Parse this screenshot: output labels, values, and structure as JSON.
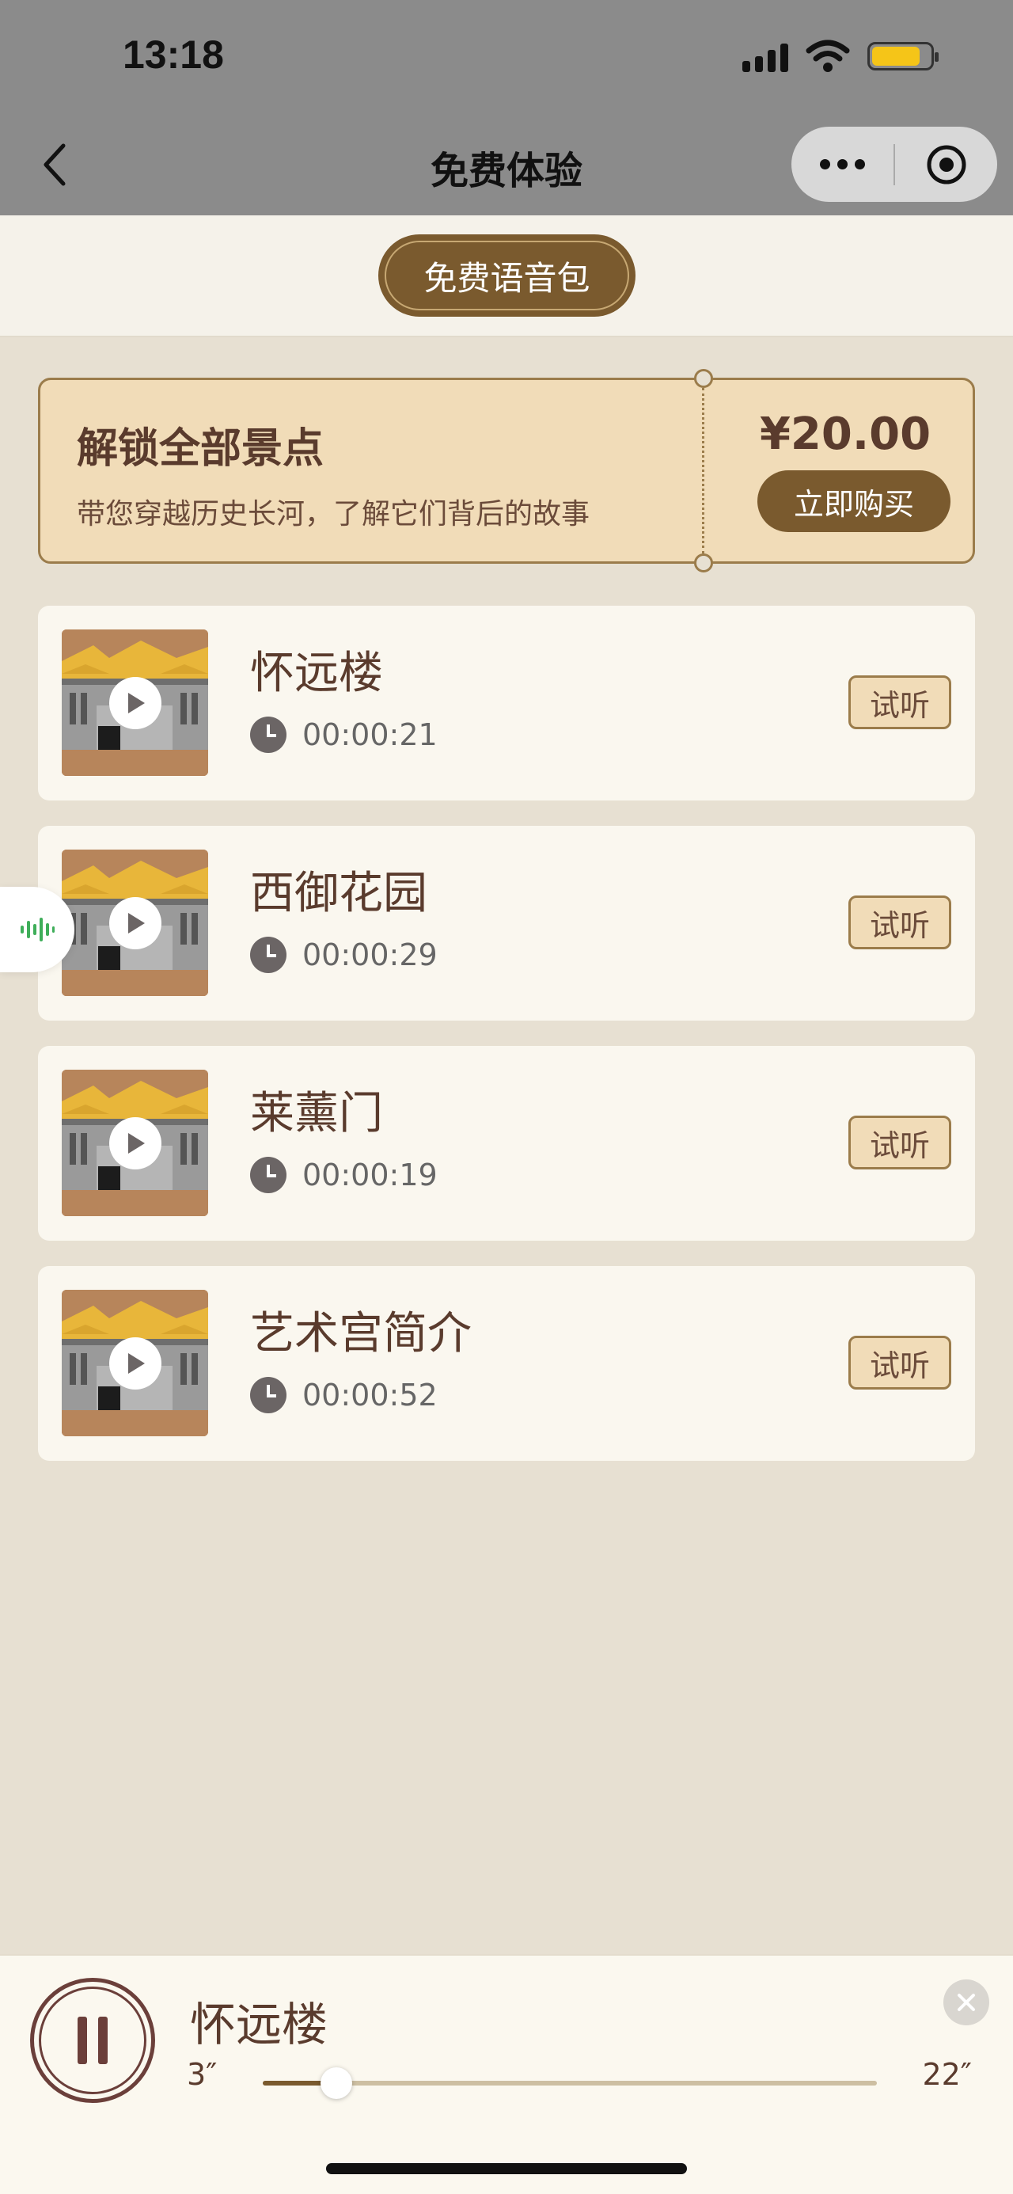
{
  "status_bar": {
    "time": "13:18",
    "battery_level": 0.84,
    "battery_color": "#f5c518"
  },
  "nav": {
    "title": "免费体验",
    "back_icon": "chevron-left-icon",
    "more_icon": "more-dots-icon",
    "close_icon": "target-circle-icon"
  },
  "header_pill": {
    "label": "免费语音包"
  },
  "unlock": {
    "title": "解锁全部景点",
    "subtitle": "带您穿越历史长河，了解它们背后的故事",
    "price": "¥20.00",
    "buy_label": "立即购买"
  },
  "items": [
    {
      "title": "怀远楼",
      "duration": "00:00:21",
      "listen_label": "试听"
    },
    {
      "title": "西御花园",
      "duration": "00:00:29",
      "listen_label": "试听"
    },
    {
      "title": "莱薰门",
      "duration": "00:00:19",
      "listen_label": "试听"
    },
    {
      "title": "艺术宫简介",
      "duration": "00:00:52",
      "listen_label": "试听"
    }
  ],
  "player": {
    "title": "怀远楼",
    "current_time": "3″",
    "total_time": "22″",
    "progress": 0.12
  },
  "colors": {
    "accent_brown": "#7a5a2e",
    "ticket_bg": "#f1dcb8",
    "page_bg": "#e7e0d2",
    "voice_green": "#3fae5a"
  }
}
